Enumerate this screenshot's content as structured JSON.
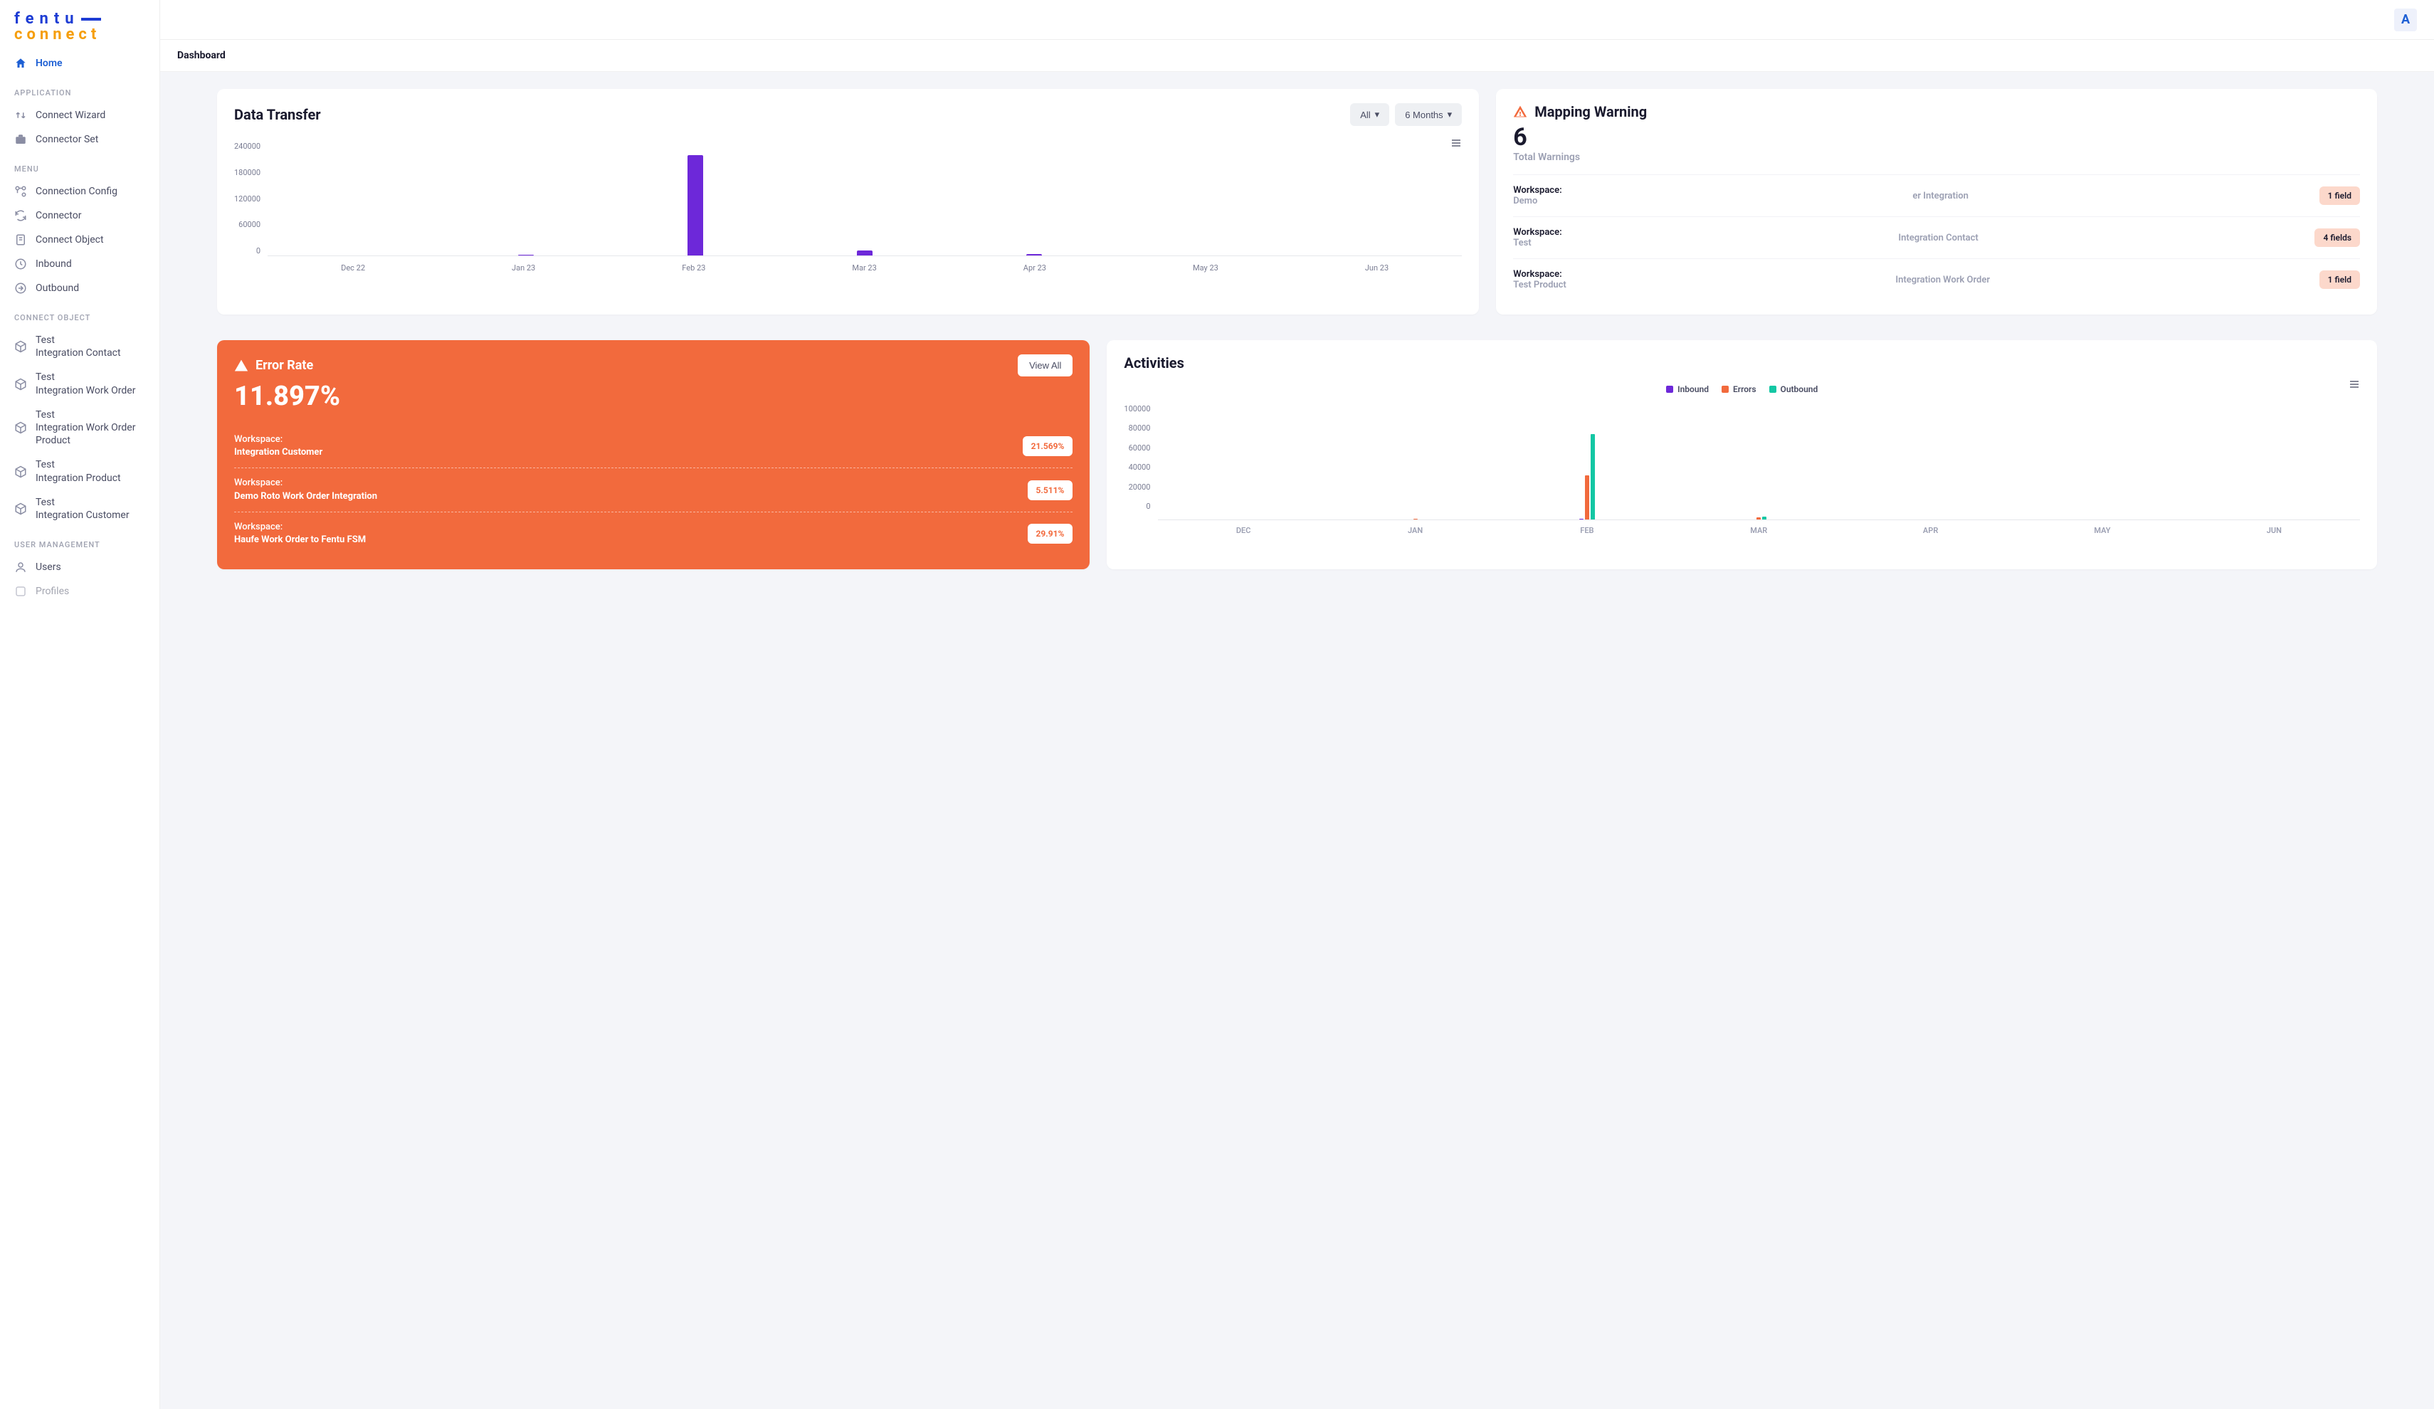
{
  "logo": {
    "line1": "fentu",
    "line2": "connect"
  },
  "breadcrumb": "Dashboard",
  "avatar_letter": "A",
  "sidebar": {
    "home_label": "Home",
    "section_application": "APPLICATION",
    "section_menu": "MENU",
    "section_connect_object": "CONNECT OBJECT",
    "section_user_management": "USER MANAGEMENT",
    "items": {
      "connect_wizard": "Connect Wizard",
      "connector_set": "Connector Set",
      "connection_config": "Connection Config",
      "connector": "Connector",
      "connect_object": "Connect Object",
      "inbound": "Inbound",
      "outbound": "Outbound",
      "users": "Users",
      "profiles": "Profiles"
    },
    "co_items": [
      {
        "l1": "Test",
        "l2": "Integration Contact"
      },
      {
        "l1": "Test",
        "l2": "Integration Work Order"
      },
      {
        "l1": "Test",
        "l2": "Integration Work Order",
        "l3": "Product"
      },
      {
        "l1": "Test",
        "l2": "Integration Product"
      },
      {
        "l1": "Test",
        "l2": "Integration Customer"
      }
    ]
  },
  "data_transfer": {
    "title": "Data Transfer",
    "filter_all": "All",
    "filter_period": "6 Months"
  },
  "chart_data": {
    "type": "bar",
    "title": "Data Transfer",
    "categories": [
      "Dec 22",
      "Jan 23",
      "Feb 23",
      "Mar 23",
      "Apr 23",
      "May 23",
      "Jun 23"
    ],
    "values": [
      0,
      2000,
      225000,
      12000,
      3000,
      0,
      0
    ],
    "ylim": [
      0,
      240000
    ],
    "yticks": [
      0,
      60000,
      120000,
      180000,
      240000
    ],
    "xlabel": "",
    "ylabel": ""
  },
  "mapping_warning": {
    "title": "Mapping Warning",
    "total": "6",
    "total_label": "Total Warnings",
    "workspace_label": "Workspace:",
    "rows": [
      {
        "ws": "Demo",
        "obj": "er Integration",
        "badge": "1 field"
      },
      {
        "ws": "Test",
        "obj": "Integration Contact",
        "badge": "4 fields"
      },
      {
        "ws": "Test Product",
        "obj": "Integration Work Order",
        "badge": "1 field"
      }
    ]
  },
  "error_rate": {
    "title": "Error Rate",
    "view_all": "View All",
    "pct": "11.897%",
    "workspace_label": "Workspace:",
    "rows": [
      {
        "name": "Integration Customer",
        "pct": "21.569%"
      },
      {
        "name": "Demo Roto Work Order Integration",
        "pct": "5.511%"
      },
      {
        "name": "Haufe Work Order to Fentu FSM",
        "pct": "29.91%"
      }
    ]
  },
  "activities": {
    "title": "Activities",
    "legend": {
      "inbound": "Inbound",
      "errors": "Errors",
      "outbound": "Outbound"
    },
    "chart": {
      "type": "bar",
      "categories": [
        "DEC",
        "JAN",
        "FEB",
        "MAR",
        "APR",
        "MAY",
        "JUN"
      ],
      "series": [
        {
          "name": "Inbound",
          "values": [
            0,
            0,
            1000,
            0,
            0,
            0,
            0
          ]
        },
        {
          "name": "Errors",
          "values": [
            0,
            500,
            43000,
            2000,
            0,
            0,
            0
          ]
        },
        {
          "name": "Outbound",
          "values": [
            0,
            0,
            83000,
            3000,
            0,
            0,
            0
          ]
        }
      ],
      "ylim": [
        0,
        100000
      ],
      "yticks": [
        0,
        20000,
        40000,
        60000,
        80000,
        100000
      ]
    }
  }
}
